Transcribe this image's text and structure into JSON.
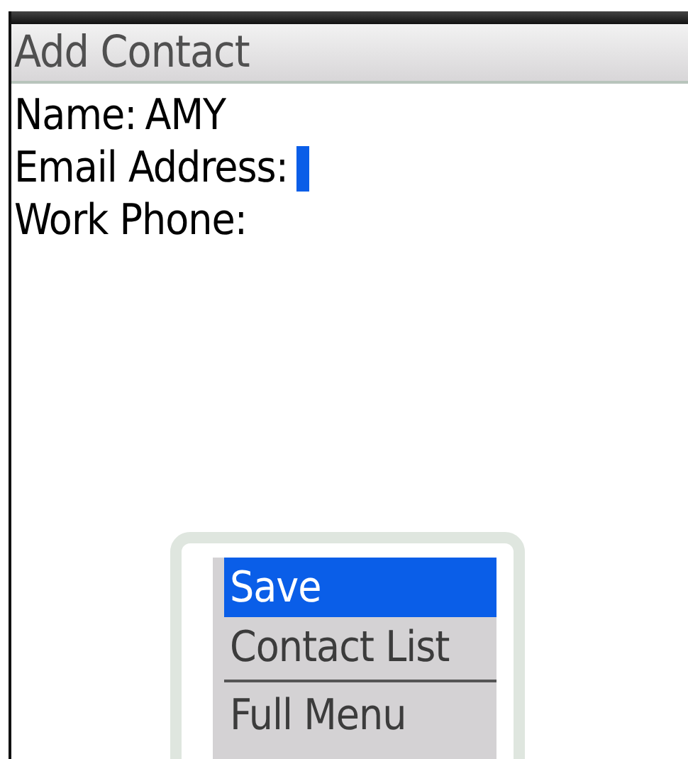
{
  "title": "Add Contact",
  "fields": [
    {
      "label": "Name:",
      "value": "AMY",
      "focused": false
    },
    {
      "label": "Email Address:",
      "focused": true
    },
    {
      "label": "Work Phone:",
      "focused": false
    }
  ],
  "menu": {
    "items": [
      {
        "label": "Save",
        "selected": true,
        "divider_after": false
      },
      {
        "label": "Contact List",
        "selected": false,
        "divider_after": true
      },
      {
        "label": "Full Menu",
        "selected": false,
        "divider_after": false
      }
    ]
  }
}
